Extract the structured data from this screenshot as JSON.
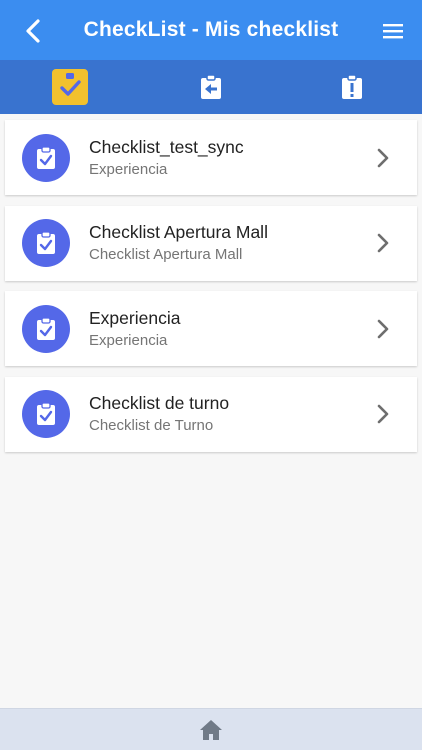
{
  "header": {
    "title": "CheckList - Mis checklist",
    "back_icon": "chevron-left-icon",
    "menu_icon": "hamburger-menu-icon",
    "background_color": "#3b8df0"
  },
  "tabs": [
    {
      "icon": "clipboard-check-icon",
      "active": true
    },
    {
      "icon": "clipboard-arrow-left-icon",
      "active": false
    },
    {
      "icon": "clipboard-alert-icon",
      "active": false
    }
  ],
  "checklists": [
    {
      "title": "Checklist_test_sync",
      "subtitle": "Experiencia"
    },
    {
      "title": "Checklist Apertura Mall",
      "subtitle": "Checklist Apertura Mall"
    },
    {
      "title": "Experiencia",
      "subtitle": "Experiencia"
    },
    {
      "title": "Checklist de turno",
      "subtitle": "Checklist de Turno"
    }
  ],
  "footer": {
    "icon": "home-icon"
  },
  "colors": {
    "accent": "#3b8df0",
    "tab_bar": "#3973cf",
    "active_tab": "#f2c12e",
    "avatar": "#5468e8"
  }
}
